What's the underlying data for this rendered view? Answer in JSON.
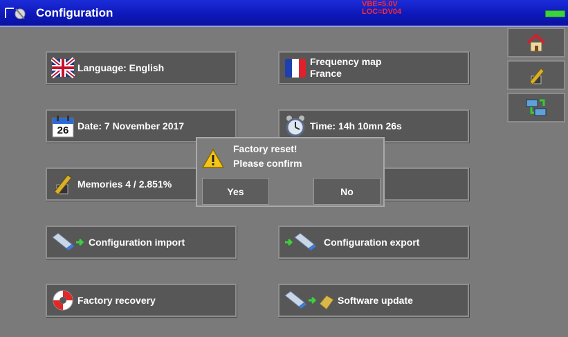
{
  "window": {
    "title": "Configuration",
    "status_line1": "VBE=5.0V",
    "status_line2": "LOC=DV04",
    "status_color": "#ff2a2a",
    "battery_color": "#3bd33b"
  },
  "side_toolbar": [
    {
      "icon": "home-icon"
    },
    {
      "icon": "memory-edit-icon"
    },
    {
      "icon": "network-icon"
    }
  ],
  "buttons": {
    "language": {
      "label": "Language: English",
      "icon": "uk-flag-icon"
    },
    "frequency_map": {
      "label_line1": "Frequency map",
      "label_line2": "France",
      "icon": "france-flag-icon"
    },
    "date": {
      "label": "Date:  7 November 2017",
      "icon": "calendar-icon",
      "calendar_day": "26"
    },
    "time": {
      "label": "Time: 14h 10mn 26s",
      "icon": "alarm-clock-icon"
    },
    "memories": {
      "label": "Memories 4 /  2.851%",
      "icon": "memory-pen-icon"
    },
    "config_import": {
      "label": "Configuration import",
      "icon": "usb-import-icon"
    },
    "config_export": {
      "label": "Configuration export",
      "icon": "usb-export-icon"
    },
    "factory_recovery": {
      "label": "Factory recovery",
      "icon": "lifebuoy-icon"
    },
    "software_update": {
      "label": "Software update",
      "icon": "usb-update-icon"
    }
  },
  "dialog": {
    "line1": "Factory reset!",
    "line2": "Please confirm",
    "yes_label": "Yes",
    "no_label": "No",
    "icon": "warning-icon"
  }
}
